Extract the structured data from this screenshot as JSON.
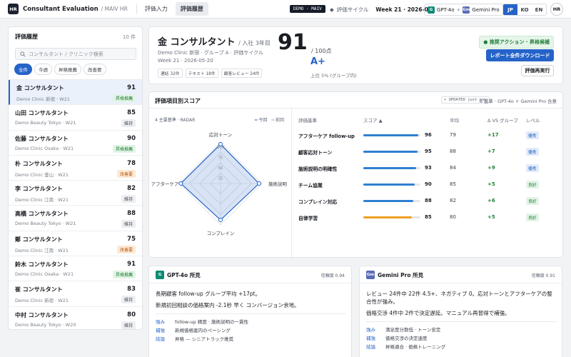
{
  "app": {
    "logo": "HR",
    "title": "Consultant Evaluation",
    "subtitle": "/ MAIV HR"
  },
  "nav": {
    "tabs": [
      "評価入力",
      "評価履歴"
    ],
    "active": 1
  },
  "topbar": {
    "demo_badge": "DEMO · MAIV",
    "cycle_label": "評価サイクル",
    "cycle_value": "Week 21 · 2026-05",
    "models": [
      {
        "badge": "G",
        "name": "GPT-4o"
      },
      {
        "badge": "Gm",
        "name": "Gemini Pro"
      }
    ],
    "models_sep": "+",
    "languages": [
      "JP",
      "KO",
      "EN"
    ],
    "language_active": "JP",
    "user_initials": "HR"
  },
  "sidebar": {
    "title": "評価履歴",
    "count": "10 件",
    "search_placeholder": "コンサルタント / クリニック検索",
    "filters": [
      "全件",
      "今週",
      "昇格推薦",
      "改善要"
    ],
    "filter_active": 0,
    "items": [
      {
        "name": "金 コンサルタント",
        "score": "91",
        "clinic": "Demo Clinic 新宿 · W21",
        "badge": "昇格推薦",
        "tone": "green",
        "selected": true
      },
      {
        "name": "山田 コンサルタント",
        "score": "85",
        "clinic": "Demo Beauty Tokyo · W21",
        "badge": "維持",
        "tone": "grey"
      },
      {
        "name": "佐藤 コンサルタント",
        "score": "90",
        "clinic": "Demo Clinic Osaka · W21",
        "badge": "昇格推薦",
        "tone": "green"
      },
      {
        "name": "朴 コンサルタント",
        "score": "78",
        "clinic": "Demo Clinic 釜山 · W21",
        "badge": "改善要",
        "tone": "orange"
      },
      {
        "name": "李 コンサルタント",
        "score": "82",
        "clinic": "Demo Clinic 江南 · W21",
        "badge": "維持",
        "tone": "grey"
      },
      {
        "name": "高橋 コンサルタント",
        "score": "88",
        "clinic": "Demo Beauty Tokyo · W21",
        "badge": "維持",
        "tone": "grey"
      },
      {
        "name": "鄭 コンサルタント",
        "score": "75",
        "clinic": "Demo Clinic 江南 · W21",
        "badge": "改善要",
        "tone": "orange"
      },
      {
        "name": "鈴木 コンサルタント",
        "score": "91",
        "clinic": "Demo Clinic Osaka · W21",
        "badge": "昇格推薦",
        "tone": "green"
      },
      {
        "name": "崔 コンサルタント",
        "score": "83",
        "clinic": "Demo Clinic 新宿 · W21",
        "badge": "維持",
        "tone": "grey"
      },
      {
        "name": "中村 コンサルタント",
        "score": "80",
        "clinic": "Demo Beauty Tokyo · W20",
        "badge": "維持",
        "tone": "grey"
      }
    ]
  },
  "profile": {
    "name": "金 コンサルタント",
    "tenure": "/ 入社 3年目",
    "desc": "Demo Clinic 新宿 · グループ A · 評価サイクル Week 21 · 2026-05-20",
    "tags": [
      "通話 32件",
      "テキスト 18件",
      "顧客レビュー 24件"
    ],
    "score": "91",
    "out_of": "/ 100点",
    "grade": "A+",
    "rank": "上位 5% (グループ内)",
    "recommend": "推奨アクション · 昇格候補",
    "download_label": "レポート全件ダウンロード",
    "rerun_label": "評価再実行"
  },
  "scores": {
    "title": "評価項目別スコア",
    "updated": "UPDATED just now",
    "meta": "6 基準 · GPT-4o + Gemini Pro 合意",
    "radar": {
      "title": "4 主要基準 · RADAR",
      "legend_current": "今回",
      "legend_prev": "前回",
      "axes": [
        "応対トーン",
        "施術説明",
        "コンプレイン",
        "アフターケア"
      ],
      "ticks": [
        "100",
        "75",
        "50",
        "25"
      ],
      "values": [
        95,
        93,
        88,
        96
      ]
    },
    "columns": [
      "評価基準",
      "スコア",
      "平均",
      "Δ VS グループ",
      "レベル"
    ],
    "rows": [
      {
        "name": "アフターケア follow-up",
        "score": 96,
        "avg": "79",
        "delta": "+17",
        "level": "優秀",
        "tone": "blue",
        "bar": "#2f7fd0"
      },
      {
        "name": "顧客応対トーン",
        "score": 95,
        "avg": "88",
        "delta": "+7",
        "level": "優秀",
        "tone": "blue",
        "bar": "#2f7fd0"
      },
      {
        "name": "施術説明の明確性",
        "score": 93,
        "avg": "84",
        "delta": "+9",
        "level": "優秀",
        "tone": "blue",
        "bar": "#2f7fd0"
      },
      {
        "name": "チーム協業",
        "score": 90,
        "avg": "85",
        "delta": "+5",
        "level": "良好",
        "tone": "green",
        "bar": "#2f7fd0"
      },
      {
        "name": "コンプレイン対応",
        "score": 88,
        "avg": "82",
        "delta": "+6",
        "level": "良好",
        "tone": "green",
        "bar": "#2f7fd0"
      },
      {
        "name": "自律学習",
        "score": 85,
        "avg": "80",
        "delta": "+5",
        "level": "良好",
        "tone": "green",
        "bar": "#f0a021"
      }
    ]
  },
  "ai": [
    {
      "badge": "G",
      "title": "GPT-4o 所見",
      "confidence": "信頼度 0.94",
      "text1": "長期顧客 follow-up グループ平均 +17pt。",
      "text2": "新規初回相談の価格案内 -2.1秒 早く コンバージョン余地。",
      "rows": [
        {
          "k": "強み",
          "v": "follow-up 精度 · 施術説明の一貫性"
        },
        {
          "k": "補強",
          "v": "新規価格案内のペーシング"
        },
        {
          "k": "結論",
          "v": "昇格 — シニアトラック推奨"
        }
      ]
    },
    {
      "badge": "Gm",
      "title": "Gemini Pro 所見",
      "confidence": "信頼度 0.91",
      "text1": "レビュー 24件中 22件 4.5+、ネガティブ 0。応対トーンとアフターケアの整合性が強み。",
      "text2": "価格交渉 4件中 2件で決定遅延。マニュアル再習得で補強。",
      "rows": [
        {
          "k": "強み",
          "v": "満足度分散低 · トーン安定"
        },
        {
          "k": "補強",
          "v": "価格交渉の決定速度"
        },
        {
          "k": "結論",
          "v": "昇格適合 · 価格トレーニング"
        }
      ]
    }
  ]
}
